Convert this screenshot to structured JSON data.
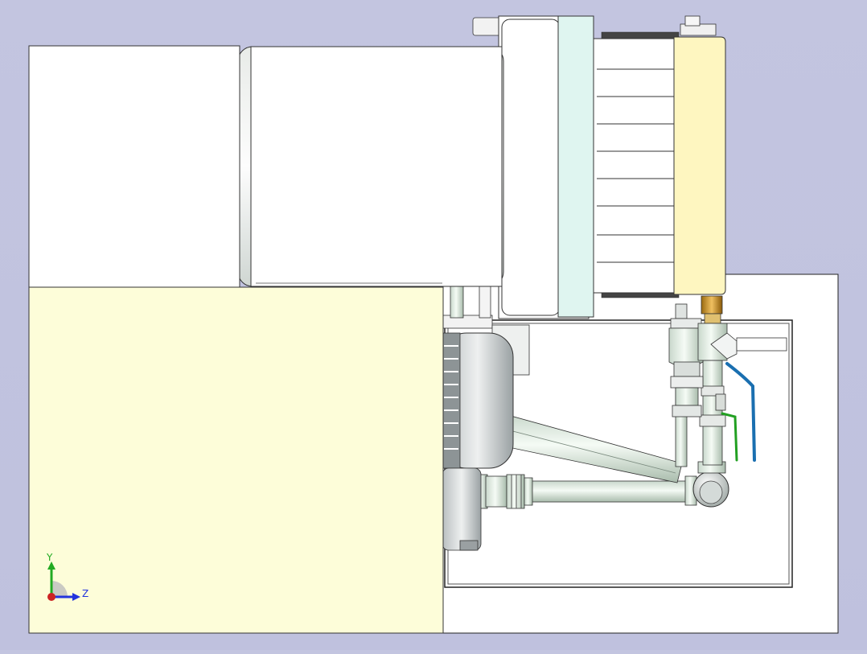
{
  "app": {
    "kind": "CAD 3D model viewport"
  },
  "triad": {
    "y_label": "Y",
    "z_label": "Z",
    "y_color": "#22aa22",
    "z_color": "#2233dd",
    "x_color": "#cc2222"
  },
  "colors": {
    "background": "#c3c5e0",
    "cream_panel": "#fdfdd9",
    "frame": "#ffffff",
    "mint_flange": "#dff5f0",
    "yellow_cover": "#fef6c0",
    "handle_blue": "#1a6fb0",
    "handle_green": "#22a022",
    "brass": "#c88a20"
  },
  "components": [
    "base-frame",
    "inner-tray",
    "cream-panel",
    "white-box",
    "cylinder-body",
    "cylinder-flange",
    "fin-block",
    "end-cover",
    "motor",
    "pipe-upper",
    "pipe-lower",
    "elbow-fitting",
    "valve-left",
    "valve-right",
    "valve-lever-blue",
    "valve-lever-green"
  ]
}
